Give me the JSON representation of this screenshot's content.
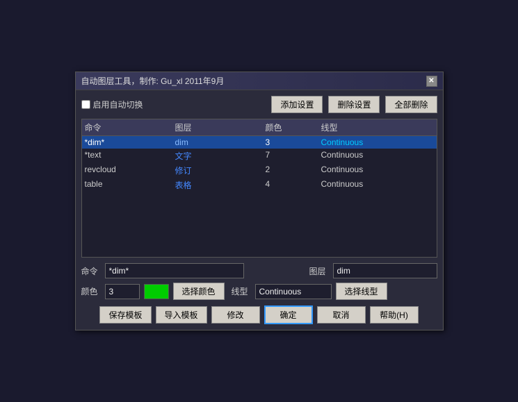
{
  "dialog": {
    "title": "自动图层工具，制作: Gu_xl  2011年9月",
    "close_label": "✕"
  },
  "toolbar": {
    "add_label": "添加设置",
    "delete_label": "删除设置",
    "delete_all_label": "全部删除"
  },
  "checkbox": {
    "label": "启用自动切换",
    "checked": false
  },
  "table": {
    "headers": [
      "命令",
      "图层",
      "颜色",
      "线型"
    ],
    "rows": [
      {
        "command": "*dim*",
        "layer": "dim",
        "color": "3",
        "linetype": "Continuous",
        "selected": true
      },
      {
        "command": "*text",
        "layer": "文字",
        "color": "7",
        "linetype": "Continuous",
        "selected": false
      },
      {
        "command": "revcloud",
        "layer": "修订",
        "color": "2",
        "linetype": "Continuous",
        "selected": false
      },
      {
        "command": "table",
        "layer": "表格",
        "color": "4",
        "linetype": "Continuous",
        "selected": false
      }
    ]
  },
  "form": {
    "command_label": "命令",
    "command_value": "*dim*",
    "command_placeholder": "",
    "layer_label": "图层",
    "layer_value": "dim",
    "color_label": "颜色",
    "color_num_value": "3",
    "color_swatch": "#00cc00",
    "choose_color_label": "选择颜色",
    "linetype_label": "线型",
    "linetype_value": "Continuous",
    "choose_linetype_label": "选择线型"
  },
  "bottom_buttons": {
    "save_template": "保存模板",
    "import_template": "导入模板",
    "modify": "修改",
    "confirm": "确定",
    "cancel": "取消",
    "help": "帮助(H)"
  }
}
